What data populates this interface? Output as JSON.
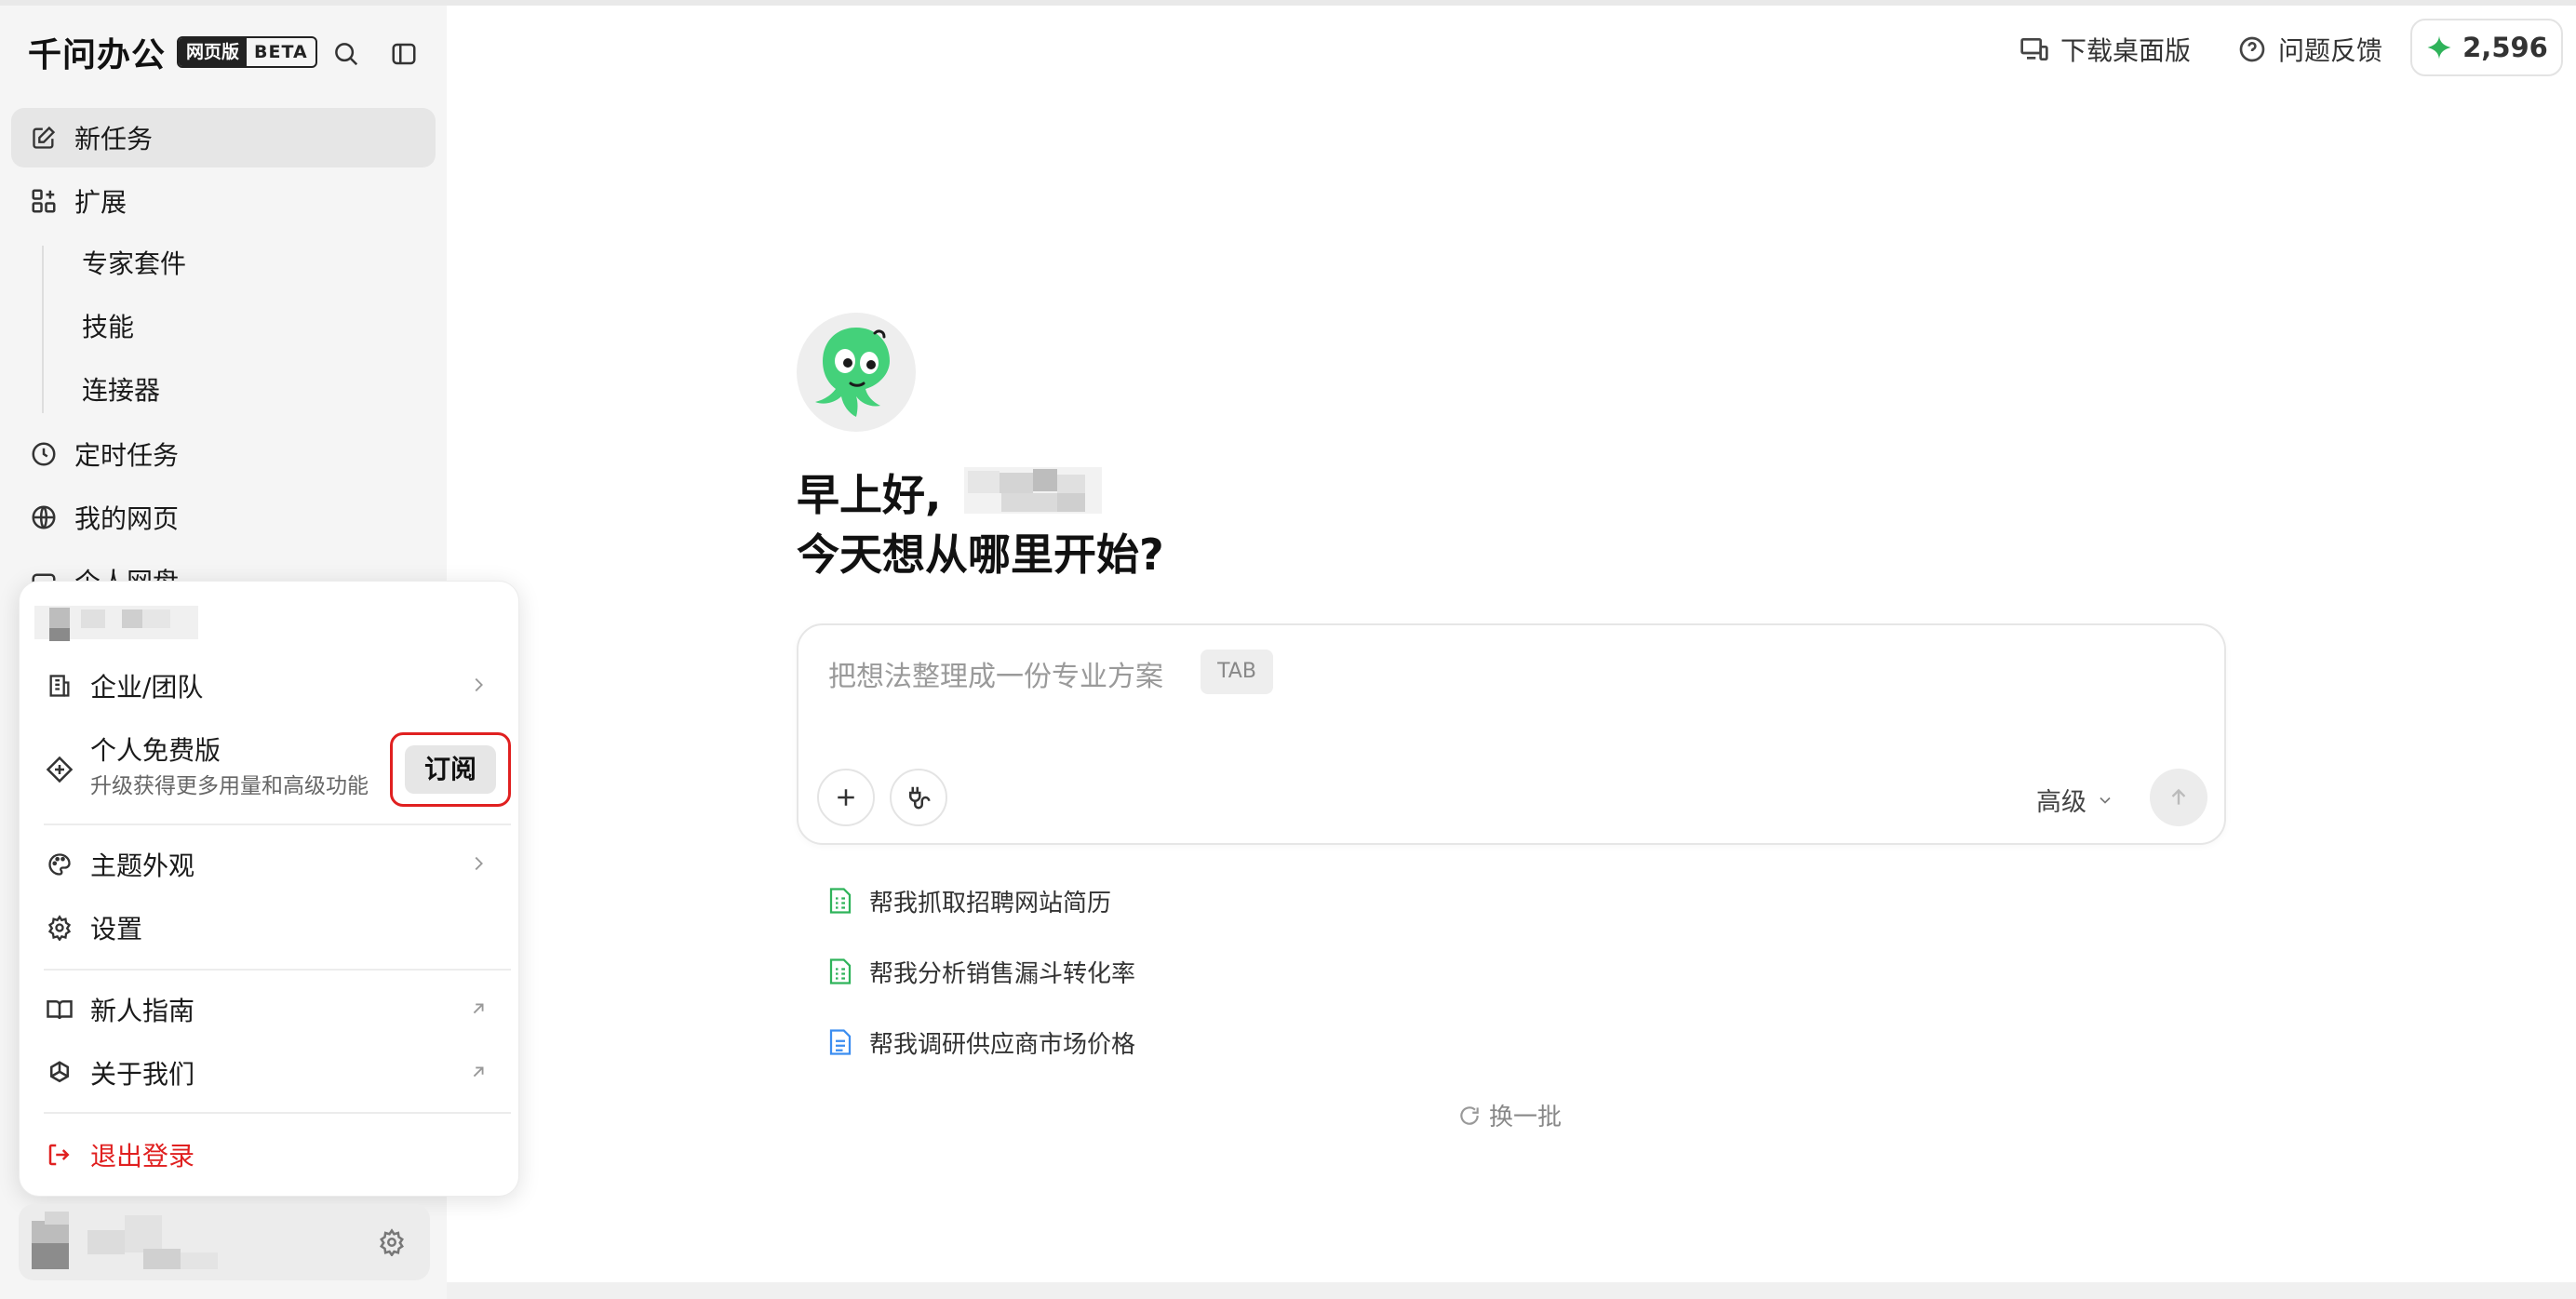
{
  "app": {
    "name": "千问办公",
    "badge_web": "网页版",
    "badge_beta": "BETA"
  },
  "sidebar": {
    "items": [
      {
        "label": "新任务",
        "icon": "edit-icon"
      },
      {
        "label": "扩展",
        "icon": "grid-plus-icon"
      },
      {
        "label": "定时任务",
        "icon": "clock-icon"
      },
      {
        "label": "我的网页",
        "icon": "globe-icon"
      },
      {
        "label": "个人网盘",
        "icon": "drive-icon"
      }
    ],
    "sub_items": [
      "专家套件",
      "技能",
      "连接器"
    ]
  },
  "popup": {
    "team": "企业/团队",
    "plan_title": "个人免费版",
    "plan_subtitle": "升级获得更多用量和高级功能",
    "subscribe": "订阅",
    "theme": "主题外观",
    "settings": "设置",
    "guide": "新人指南",
    "about": "关于我们",
    "logout": "退出登录"
  },
  "header": {
    "download": "下载桌面版",
    "feedback": "问题反馈",
    "credits": "2,596"
  },
  "main": {
    "greeting": "早上好,",
    "headline": "今天想从哪里开始?",
    "input_placeholder": "把想法整理成一份专业方案",
    "tab_hint": "TAB",
    "advanced": "高级",
    "suggestions": [
      {
        "text": "帮我抓取招聘网站简历",
        "icon": "sheet-icon"
      },
      {
        "text": "帮我分析销售漏斗转化率",
        "icon": "sheet-icon"
      },
      {
        "text": "帮我调研供应商市场价格",
        "icon": "doc-icon"
      }
    ],
    "refresh": "换一批"
  },
  "colors": {
    "accent_green": "#2fb35a",
    "danger_red": "#e02020",
    "mascot_green": "#44d17a"
  }
}
